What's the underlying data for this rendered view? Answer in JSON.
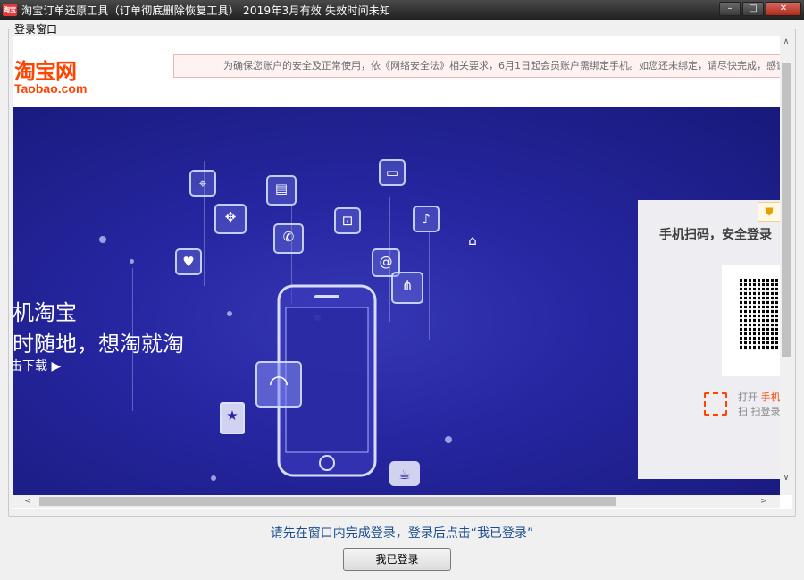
{
  "window": {
    "icon_label": "淘宝",
    "title": "淘宝订单还原工具（订单彻底删除恢复工具） 2019年3月有效 失效时间未知",
    "minimize": "–",
    "maximize": "□",
    "close": "✕"
  },
  "group": {
    "legend": "登录窗口"
  },
  "page": {
    "logo_cn": "淘宝网",
    "logo_en": "Taobao.com",
    "notice": "为确保您账户的安全及正常使用，依《网络安全法》相关要求，6月1日起会员账户需绑定手机。如您还未绑定，请尽快完成，感谢您的理解",
    "hero": {
      "line1": "机淘宝",
      "line2": "时随地，想淘就淘",
      "download": "击下载 ▶"
    },
    "login": {
      "shield": "⛊",
      "title": "手机扫码，安全登录",
      "scan_text_prefix": "打开 ",
      "scan_text_highlight": "手机",
      "scan_text2": "扫 扫登录"
    },
    "icons": [
      "map-pin",
      "briefcase",
      "tv",
      "gamepad",
      "lock",
      "microphone",
      "hanger",
      "phone",
      "at-sign",
      "heart",
      "share",
      "wifi",
      "shopping-bag",
      "coffee-cup"
    ]
  },
  "scroll": {
    "up": "∧",
    "down": "∨",
    "left": "<",
    "right": ">"
  },
  "footer": {
    "instruction": "请先在窗口内完成登录，登录后点击“我已登录”",
    "button": "我已登录"
  }
}
